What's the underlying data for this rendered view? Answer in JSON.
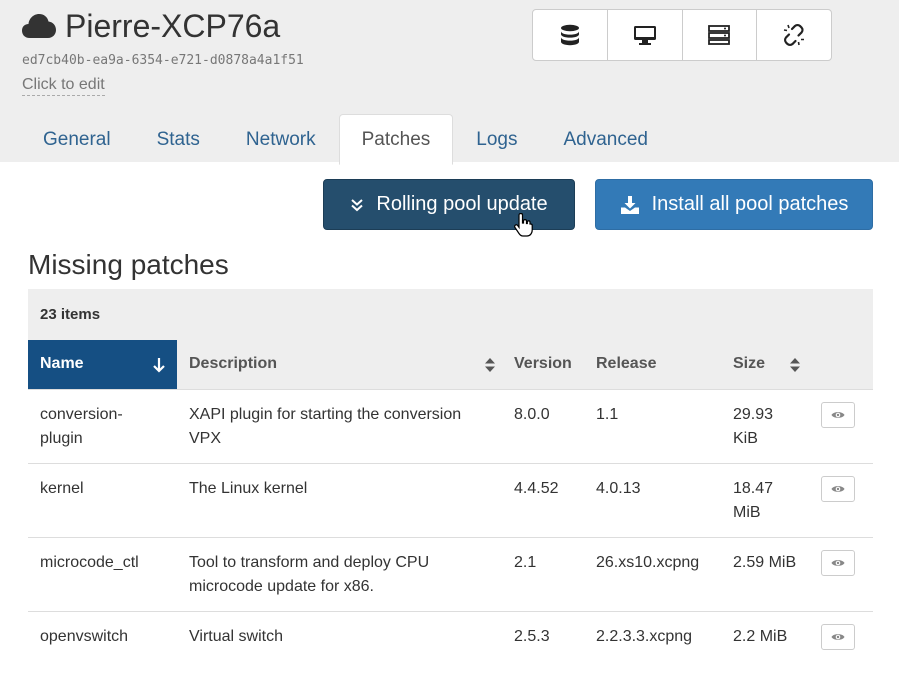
{
  "host": {
    "icon": "cloud-icon",
    "title": "Pierre-XCP76a",
    "uuid": "ed7cb40b-ea9a-6354-e721-d0878a4a1f51",
    "edit_hint": "Click to edit"
  },
  "quick_actions": [
    {
      "icon": "database-icon"
    },
    {
      "icon": "desktop-icon"
    },
    {
      "icon": "server-icon"
    },
    {
      "icon": "unlink-icon"
    }
  ],
  "tabs": [
    {
      "label": "General"
    },
    {
      "label": "Stats"
    },
    {
      "label": "Network"
    },
    {
      "label": "Patches",
      "active": true
    },
    {
      "label": "Logs"
    },
    {
      "label": "Advanced"
    }
  ],
  "actions": {
    "rolling_update": "Rolling pool update",
    "install_all": "Install all pool patches"
  },
  "section_title": "Missing patches",
  "table": {
    "item_count": "23 items",
    "columns": [
      "Name",
      "Description",
      "Version",
      "Release",
      "Size"
    ],
    "rows": [
      {
        "name": "conversion-plugin",
        "description": "XAPI plugin for starting the conversion VPX",
        "version": "8.0.0",
        "release": "1.1",
        "size": "29.93 KiB"
      },
      {
        "name": "kernel",
        "description": "The Linux kernel",
        "version": "4.4.52",
        "release": "4.0.13",
        "size": "18.47 MiB"
      },
      {
        "name": "microcode_ctl",
        "description": "Tool to transform and deploy CPU microcode update for x86.",
        "version": "2.1",
        "release": "26.xs10.xcpng",
        "size": "2.59 MiB"
      },
      {
        "name": "openvswitch",
        "description": "Virtual switch",
        "version": "2.5.3",
        "release": "2.2.3.3.xcpng",
        "size": "2.2 MiB"
      }
    ]
  },
  "colors": {
    "header_bg": "#eeeeee",
    "primary": "#337ab7",
    "primary_dark": "#254e6d",
    "sorted_header": "#154f83",
    "tab_link": "#2f6390"
  }
}
